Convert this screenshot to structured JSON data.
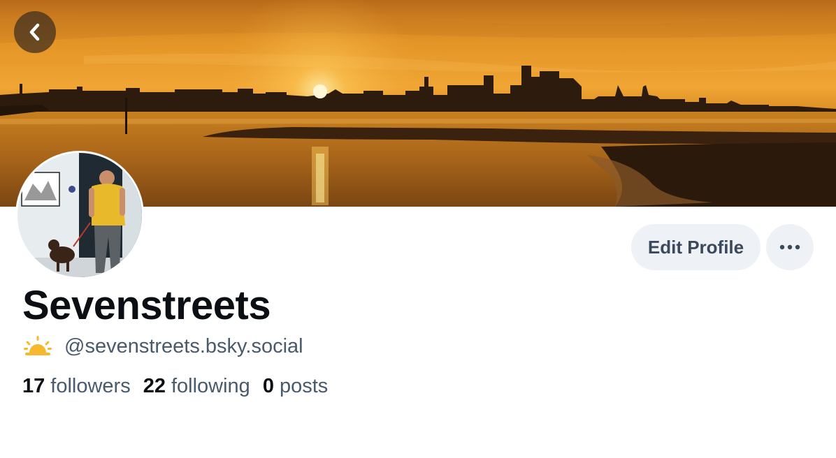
{
  "header": {
    "banner_icon": "sunset-skyline-photo",
    "back_icon": "chevron-left-icon"
  },
  "profile": {
    "avatar_icon": "person-with-dog-photo",
    "display_name": "Sevenstreets",
    "handle_emoji_icon": "sunrise-emoji-icon",
    "handle": "@sevenstreets.bsky.social"
  },
  "actions": {
    "edit_label": "Edit Profile",
    "more_icon": "ellipsis-icon"
  },
  "stats": {
    "followers_count": "17",
    "followers_label": "followers",
    "following_count": "22",
    "following_label": "following",
    "posts_count": "0",
    "posts_label": "posts"
  },
  "colors": {
    "name_text": "#0b0f14",
    "secondary_text": "#485a6c",
    "button_bg": "#eef1f5",
    "emoji_sun": "#f5b82e"
  }
}
